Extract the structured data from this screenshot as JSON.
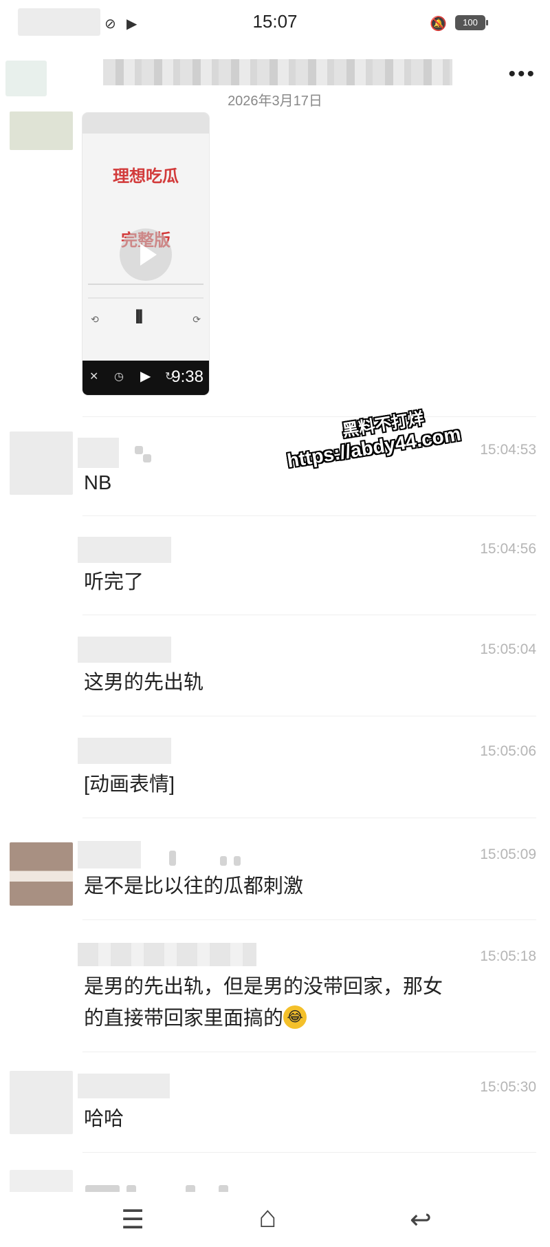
{
  "status_bar": {
    "time": "15:07",
    "battery": "100",
    "icons": [
      "sync-icon",
      "video-icon",
      "bell-mute-icon",
      "battery-icon"
    ]
  },
  "chat": {
    "date": "2026年3月17日",
    "more_label": "•••"
  },
  "video": {
    "title_line1": "理想吃瓜",
    "title_line2": "完整版",
    "duration": "9:38"
  },
  "messages": [
    {
      "time": "15:04:53",
      "text": "NB"
    },
    {
      "time": "15:04:56",
      "text": "听完了"
    },
    {
      "time": "15:05:04",
      "text": "这男的先出轨"
    },
    {
      "time": "15:05:06",
      "text": "[动画表情]"
    },
    {
      "time": "15:05:09",
      "text": "是不是比以往的瓜都刺激"
    },
    {
      "time": "15:05:18",
      "text": "是男的先出轨，但是男的没带回家，那女",
      "text2": "的直接带回家里面搞的"
    },
    {
      "time": "15:05:30",
      "text": "哈哈"
    }
  ],
  "watermark": {
    "line1": "黑料不打烊",
    "line2": "https://abdy44.com"
  },
  "nav": {
    "menu": "☰",
    "home": "⌂",
    "back": "↩"
  }
}
